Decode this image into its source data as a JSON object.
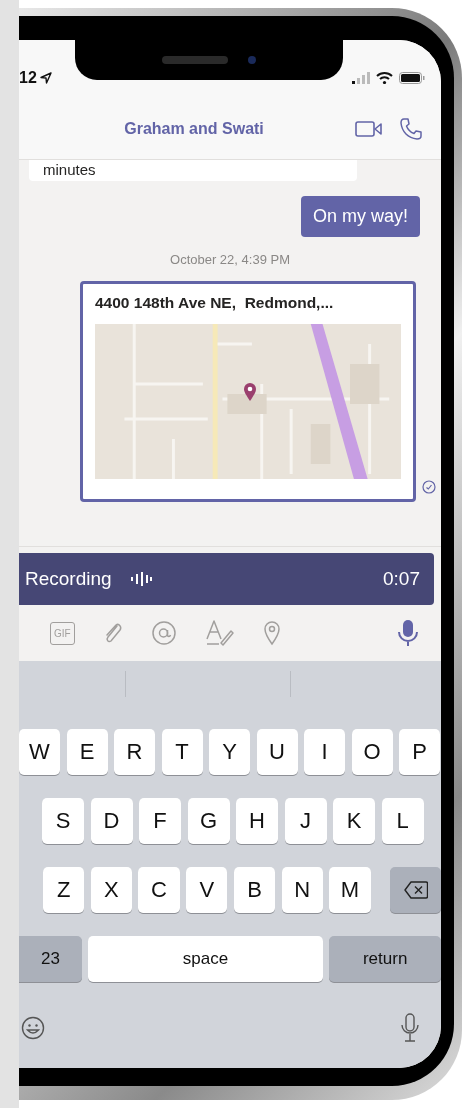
{
  "status_bar": {
    "time": "12"
  },
  "header": {
    "title": "Graham and Swati"
  },
  "messages": [
    {
      "kind": "received",
      "text": "minutes"
    },
    {
      "kind": "sent",
      "text": "On my way!"
    },
    {
      "kind": "timestamp",
      "text": "October 22, 4:39 PM"
    },
    {
      "kind": "location",
      "text": "4400 148th Ave NE,  Redmond,..."
    }
  ],
  "recording": {
    "label": "Recording",
    "duration": "0:07"
  },
  "toolbar": {
    "gif_label": "GIF"
  },
  "keyboard": {
    "rows": [
      [
        "W",
        "E",
        "R",
        "T",
        "Y",
        "U",
        "I",
        "O",
        "P"
      ],
      [
        "S",
        "D",
        "F",
        "G",
        "H",
        "J",
        "K",
        "L"
      ],
      [
        "Z",
        "X",
        "C",
        "V",
        "B",
        "N",
        "M"
      ]
    ],
    "numbers_key": "23",
    "space_key": "space",
    "return_key": "return"
  }
}
